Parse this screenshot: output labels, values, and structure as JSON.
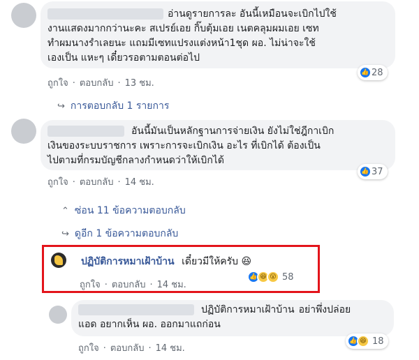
{
  "comments": [
    {
      "text_lines": [
        "อ่านดูรายการละ อันนี้เหมือนจะเบิกไปใช้",
        "งานแสดงมากกว่านะคะ สเปรย์เอย กิ๊บตุ้มเอย เนตคลุมผมเอย เซท",
        "ทำผมนางรำเลยนะ แถมมีเซทแปรงแต่งหน้า1ชุด ผอ. ไม่น่าจะใช้",
        "เองเป็น แหะๆ เดี๋ยวรอตามตอนต่อไป"
      ],
      "like": "ถูกใจ",
      "reply": "ตอบกลับ",
      "time": "13 ชม.",
      "reactions": "28"
    },
    {
      "text_lines": [
        "อันนี้มันเป็นหลักฐานการจ่ายเงิน ยังไม่ใช่ฎีกาเบิก",
        "เงินของระบบราชการ เพราะการจะเบิกเงิน อะไร ที่เบิกได้ ต้องเป็น",
        "ไปตามที่กรมบัญชีกลางกำหนดว่าให้เบิกได้"
      ],
      "like": "ถูกใจ",
      "reply": "ตอบกลับ",
      "time": "14 ชม.",
      "reactions": "37"
    }
  ],
  "replies_link_1": "การตอบกลับ 1 รายการ",
  "hide_replies": "ซ่อน 11 ข้อความตอบกลับ",
  "see_more": "ดูอีก 1 ข้อความตอบกลับ",
  "highlighted_reply": {
    "name": "ปฏิบัติการหมาเฝ้าบ้าน",
    "text": "เดี๋ยวมีให้ครับ 😆",
    "like": "ถูกใจ",
    "reply": "ตอบกลับ",
    "time": "14 ชม.",
    "reactions": "58"
  },
  "last_reply": {
    "tag": "ปฏิบัติการหมาเฝ้าบ้าน",
    "text_line1": "อย่าพึ่งปล่อย",
    "text_line2": "แอด อยากเห็น ผอ. ออกมาแถก่อน",
    "like": "ถูกใจ",
    "reply": "ตอบกลับ",
    "time": "14 ชม.",
    "reactions": "18"
  },
  "colors": {
    "accent": "#385898",
    "highlight_border": "#e3141b",
    "like_blue": "#1877f2"
  },
  "icons": [
    "like-icon",
    "haha-icon",
    "wow-icon",
    "reply-arrow-icon",
    "hide-arrow-icon"
  ]
}
